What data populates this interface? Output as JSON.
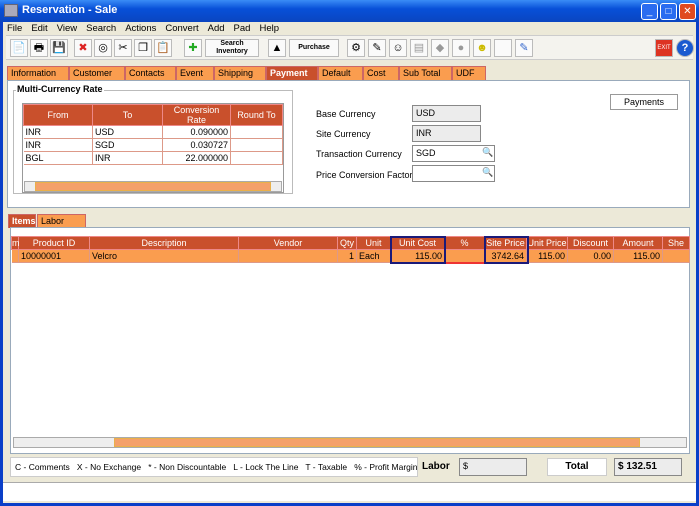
{
  "window": {
    "title": "Reservation - Sale",
    "controls": [
      "minimize",
      "maximize",
      "close"
    ]
  },
  "menu": [
    "File",
    "Edit",
    "View",
    "Search",
    "Actions",
    "Convert",
    "Add",
    "Pad",
    "Help"
  ],
  "toolbar": {
    "search_inventory": "Search Inventory",
    "purchase": "Purchase",
    "exit": "EXIT"
  },
  "tabs": [
    "Information",
    "Customer",
    "Contacts",
    "Event",
    "Shipping",
    "Payment",
    "Default",
    "Cost",
    "Sub Total",
    "UDF"
  ],
  "active_tab": "Payment",
  "multi_currency": {
    "legend": "Multi-Currency Rate",
    "columns": [
      "From",
      "To",
      "Conversion Rate",
      "Round To"
    ],
    "rows": [
      [
        "INR",
        "USD",
        "0.090000",
        ""
      ],
      [
        "INR",
        "SGD",
        "0.030727",
        ""
      ],
      [
        "BGL",
        "INR",
        "22.000000",
        ""
      ]
    ]
  },
  "currency": {
    "base_label": "Base Currency",
    "base_value": "USD",
    "site_label": "Site Currency",
    "site_value": "INR",
    "transaction_label": "Transaction Currency",
    "transaction_value": "SGD",
    "price_factor_label": "Price Conversion Factor",
    "price_factor_value": ""
  },
  "payments_button": "Payments",
  "sub_tabs": [
    "Items",
    "Labor"
  ],
  "items": {
    "columns": [
      "m",
      "Product ID",
      "Description",
      "Vendor",
      "Qty",
      "Unit",
      "Unit Cost",
      "%",
      "Site Price",
      "Unit Price",
      "Discount",
      "Amount",
      "She"
    ],
    "rows": [
      [
        "",
        "10000001",
        "Velcro",
        "",
        "1",
        "Each",
        "115.00",
        "",
        "3742.64",
        "115.00",
        "0.00",
        "115.00",
        ""
      ]
    ]
  },
  "legend_text": "C - Comments   X - No Exchange   * - Non Discountable   L - Lock The Line   T - Taxable   % - Profit Margin",
  "labor": {
    "label": "Labor",
    "value": "$"
  },
  "total": {
    "label": "Total",
    "value": "$ 132.51"
  },
  "colors": {
    "accent": "#c9502c",
    "tab": "#fa9d4f",
    "title_bar": "#0850d8"
  }
}
